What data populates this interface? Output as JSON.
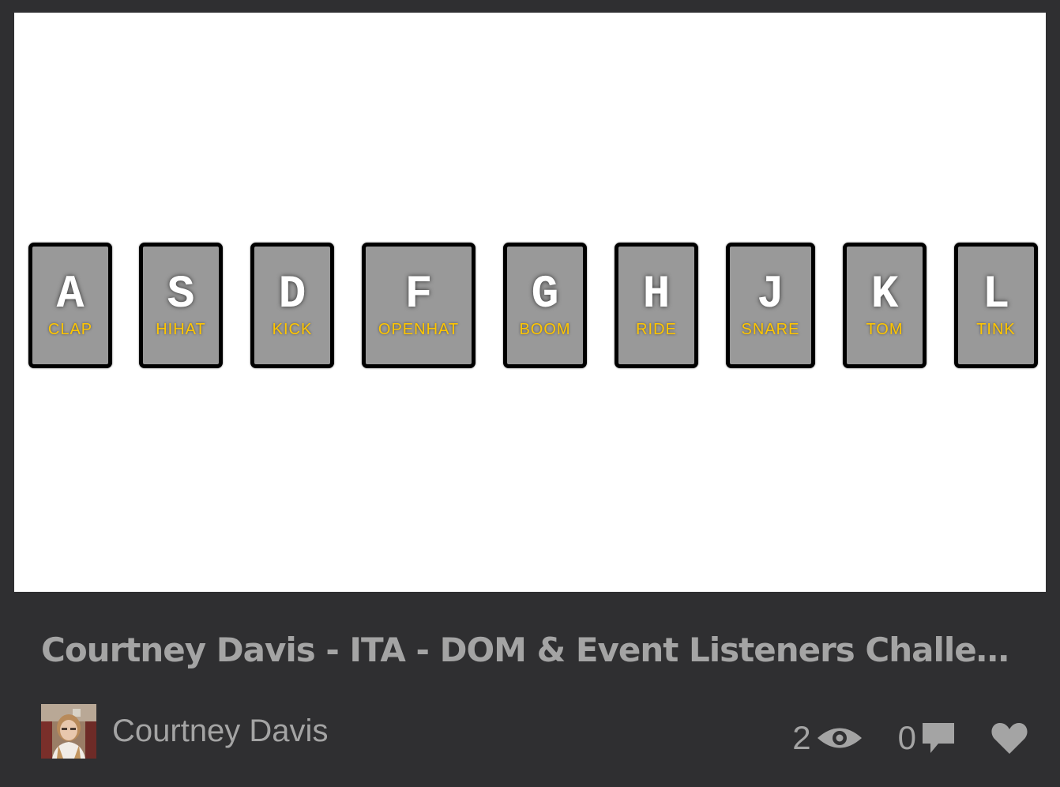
{
  "keys": [
    {
      "letter": "A",
      "sound": "CLAP"
    },
    {
      "letter": "S",
      "sound": "HIHAT"
    },
    {
      "letter": "D",
      "sound": "KICK"
    },
    {
      "letter": "F",
      "sound": "OPENHAT"
    },
    {
      "letter": "G",
      "sound": "BOOM"
    },
    {
      "letter": "H",
      "sound": "RIDE"
    },
    {
      "letter": "J",
      "sound": "SNARE"
    },
    {
      "letter": "K",
      "sound": "TOM"
    },
    {
      "letter": "L",
      "sound": "TINK"
    }
  ],
  "pen": {
    "title": "Courtney Davis - ITA - DOM & Event Listeners Challen...",
    "author": "Courtney Davis"
  },
  "stats": {
    "views": "2",
    "comments": "0"
  },
  "icons": {
    "views": "eye-icon",
    "comments": "comment-icon",
    "likes": "heart-icon"
  },
  "colors": {
    "background": "#2f2f31",
    "key_bg": "#999999",
    "key_border": "#000000",
    "sound_label": "#ffc600",
    "muted_text": "#a4a4a4"
  }
}
